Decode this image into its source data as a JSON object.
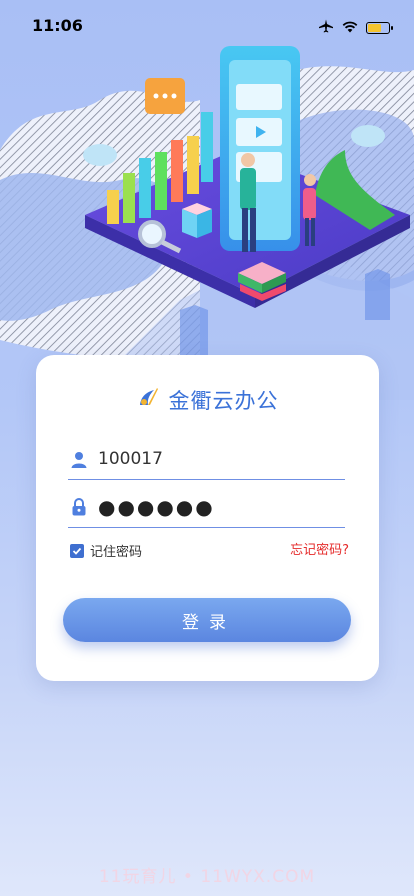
{
  "status_bar": {
    "time": "11:06",
    "battery_level": 0.7
  },
  "brand": {
    "title": "金衢云办公",
    "accent": "#3b72d8"
  },
  "login": {
    "username_value": "100017",
    "password_masked": "●●●●●●",
    "remember_label": "记住密码",
    "remember_checked": true,
    "forgot_label": "忘记密码?",
    "submit_label": "登录"
  },
  "watermark": "11玩育儿 • 11WYX.COM",
  "colors": {
    "primary": "#3b72d8",
    "forgot": "#e52b2b",
    "button": "#6b95e6"
  },
  "icons": [
    "airplane-icon",
    "wifi-icon",
    "battery-icon",
    "user-icon",
    "lock-icon",
    "checkbox-icon",
    "brand-logo-icon"
  ]
}
